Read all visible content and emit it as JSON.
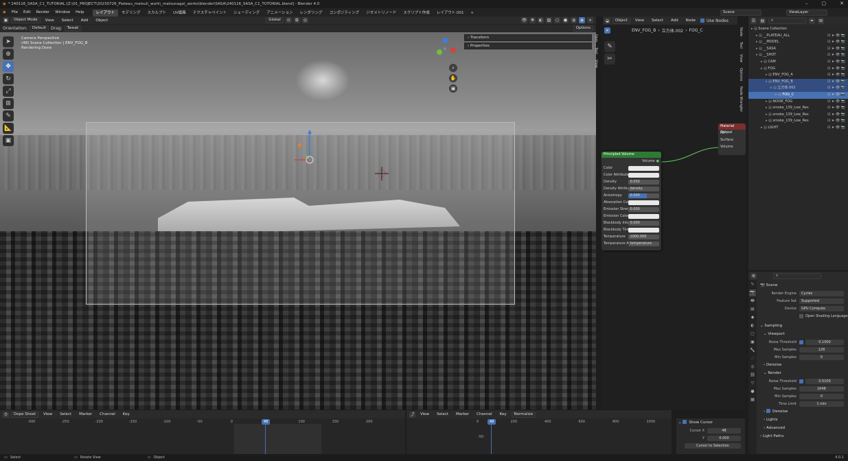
{
  "titlebar": {
    "title": "* 240116_SASA_C1_TUTORIAL [Z:\\01_PROJECT\\20230726_Plateau_matsui\\_work\\_matsunaga\\_works\\blender\\SASA\\240116_SASA_C1_TUTORIAL.blend] - Blender 4.0"
  },
  "menubar": {
    "items": [
      "File",
      "Edit",
      "Render",
      "Window",
      "Help"
    ],
    "workspaces": [
      "レイアウト",
      "モデリング",
      "スカルプト",
      "UV編集",
      "テクスチャペイント",
      "シェーディング",
      "アニメーション",
      "レンダリング",
      "コンポジティング",
      "ジオメトリノード",
      "スクリプト作成",
      "レイアウト.001",
      "+"
    ],
    "scene": "Scene",
    "viewlayer": "ViewLayer"
  },
  "viewport": {
    "mode": "Object Mode",
    "menus": [
      "View",
      "Select",
      "Add",
      "Object"
    ],
    "transform": "Global",
    "orientation_label": "Orientation:",
    "orientation": "Default",
    "drag_label": "Drag:",
    "drag": "Tweak",
    "options": "Options",
    "info": [
      "Camera Perspective",
      "(48) Scene Collection | ENV_FOG_B",
      "Rendering Done"
    ],
    "npanel": [
      "Transform",
      "Properties"
    ],
    "tabs": [
      "Item",
      "Tool",
      "View"
    ]
  },
  "node_editor": {
    "type_label": "Object",
    "menus": [
      "View",
      "Select",
      "Add",
      "Node"
    ],
    "use_nodes": "Use Nodes",
    "breadcrumb": [
      "ENV_FOG_B",
      "立方体.002",
      "FOG_C"
    ],
    "tabs": [
      "Node",
      "Tool",
      "View",
      "Options",
      "Node Wrangler"
    ],
    "node": {
      "title": "Principled Volume",
      "output": "Volume",
      "rows": [
        {
          "l": "Color",
          "v": ""
        },
        {
          "l": "Color Attribute",
          "v": ""
        },
        {
          "l": "Density",
          "v": "0.050"
        },
        {
          "l": "Density Attribute",
          "v": "density"
        },
        {
          "l": "Anisotropy",
          "v": "0.000"
        },
        {
          "l": "Absorption Color",
          "v": ""
        },
        {
          "l": "Emission Strength",
          "v": "0.000"
        },
        {
          "l": "Emission Color",
          "v": ""
        },
        {
          "l": "Blackbody Intensity",
          "v": "0.000"
        },
        {
          "l": "Blackbody Tint",
          "v": ""
        },
        {
          "l": "Temperature",
          "v": "1000.000"
        },
        {
          "l": "Temperature Attribute",
          "v": "temperature"
        }
      ]
    },
    "output_node": {
      "title": "Material Output",
      "rows": [
        "All",
        "Surface",
        "Volume",
        "Displacement"
      ]
    }
  },
  "outliner": {
    "rows": [
      {
        "t": "Scene Collection",
        "d": 0,
        "s": ""
      },
      {
        "t": "__PLATEAU_ALL",
        "d": 1,
        "s": ""
      },
      {
        "t": "__MODEL",
        "d": 1,
        "s": ""
      },
      {
        "t": "__SASA",
        "d": 1,
        "s": ""
      },
      {
        "t": "__SHOT",
        "d": 1,
        "s": ""
      },
      {
        "t": "CAM",
        "d": 2,
        "s": ""
      },
      {
        "t": "FOG",
        "d": 2,
        "s": ""
      },
      {
        "t": "ENV_FOG_A",
        "d": 3,
        "s": ""
      },
      {
        "t": "ENV_FOG_B",
        "d": 3,
        "s": "sel"
      },
      {
        "t": "立方体.002",
        "d": 4,
        "s": "sel"
      },
      {
        "t": "FOG_C",
        "d": 5,
        "s": "act"
      },
      {
        "t": "NOISE_FOG",
        "d": 3,
        "s": ""
      },
      {
        "t": "smoke_139_Low_Res",
        "d": 3,
        "s": ""
      },
      {
        "t": "smoke_139_Low_Res",
        "d": 3,
        "s": ""
      },
      {
        "t": "smoke_139_Low_Res",
        "d": 3,
        "s": ""
      },
      {
        "t": "LIGHT",
        "d": 2,
        "s": ""
      }
    ]
  },
  "properties": {
    "scene": "Scene",
    "render_engine": {
      "l": "Render Engine",
      "v": "Cycles"
    },
    "feature_set": {
      "l": "Feature Set",
      "v": "Supported"
    },
    "device": {
      "l": "Device",
      "v": "GPU Compute"
    },
    "osl": "Open Shading Language",
    "sampling": "Sampling",
    "viewport_sec": "Viewport",
    "vp_noise": {
      "l": "Noise Threshold",
      "v": "0.1000"
    },
    "vp_max": {
      "l": "Max Samples",
      "v": "128"
    },
    "vp_min": {
      "l": "Min Samples",
      "v": "0"
    },
    "denoise": "Denoise",
    "render_sec": "Render",
    "r_noise": {
      "l": "Noise Threshold",
      "v": "0.0100"
    },
    "r_max": {
      "l": "Max Samples",
      "v": "2048"
    },
    "r_min": {
      "l": "Min Samples",
      "v": "0"
    },
    "r_time": {
      "l": "Time Limit",
      "v": "1 min"
    },
    "denoise2": "Denoise",
    "lights": "Lights",
    "advanced": "Advanced",
    "light_paths": "Light Paths"
  },
  "dopesheet": {
    "mode": "Dope Sheet",
    "menus": [
      "View",
      "Select",
      "Marker",
      "Channel",
      "Key"
    ],
    "ticks": [
      "-300",
      "-250",
      "-200",
      "-150",
      "-100",
      "-50",
      "0",
      "50",
      "100",
      "150",
      "200"
    ],
    "frame": "48"
  },
  "graph": {
    "menus": [
      "View",
      "Select",
      "Marker",
      "Channel",
      "Key"
    ],
    "normalize": "Normalize",
    "ticks": [
      "0",
      "200",
      "400",
      "600",
      "800",
      "1000"
    ],
    "frame": "48",
    "ylabel": "-50",
    "show_cursor": "Show Cursor",
    "cursor_x_label": "Cursor X",
    "cursor_x": "48",
    "y_label": "Y",
    "y": "0.000",
    "to_selection": "Cursor to Selection"
  },
  "statusbar": {
    "select": "Select",
    "rotate": "Rotate View",
    "object": "Object",
    "version": "4.0.1"
  }
}
